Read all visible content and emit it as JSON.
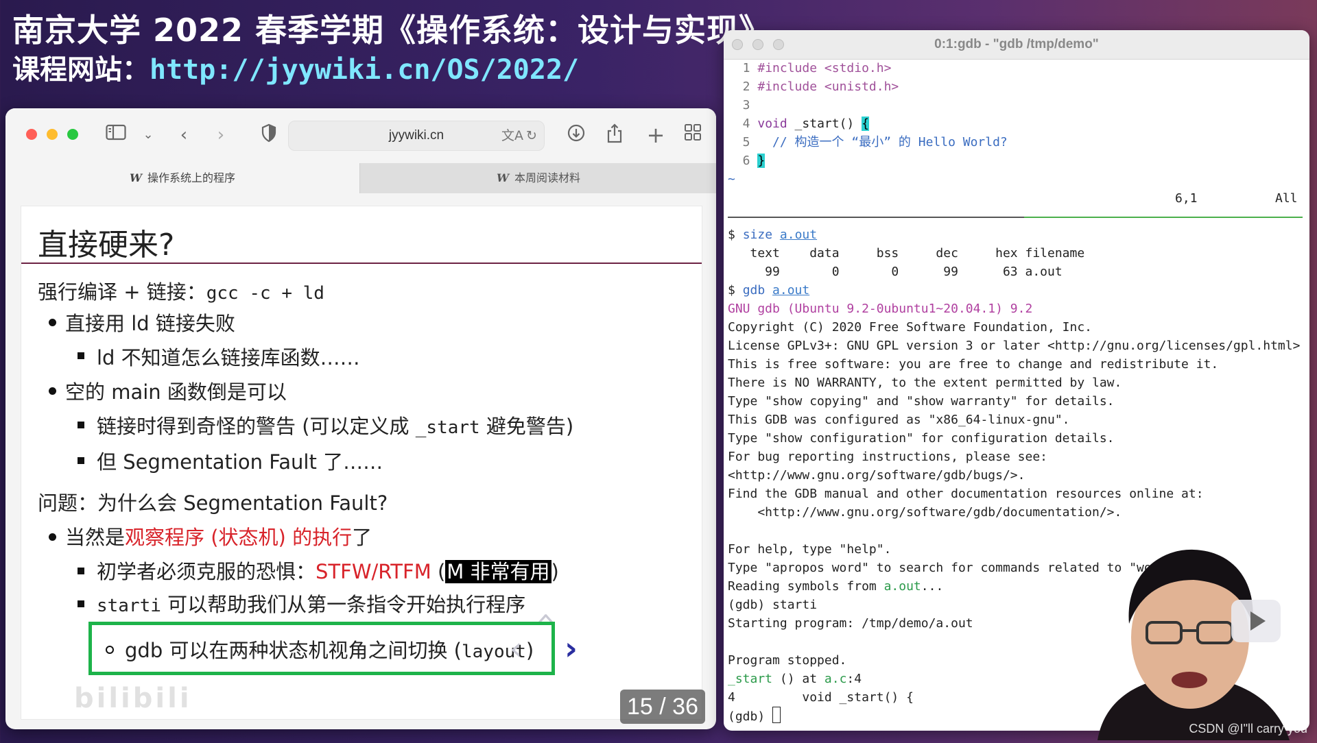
{
  "headline": {
    "line1": "南京大学 2022 春季学期《操作系统：设计与实现》",
    "line2_label": "课程网站：",
    "line2_url": "http://jyywiki.cn/OS/2022/"
  },
  "browser": {
    "url": "jyywiki.cn",
    "tabs": [
      {
        "label": "操作系统上的程序",
        "active": true
      },
      {
        "label": "本周阅读材料",
        "active": false
      }
    ],
    "icons": [
      "sidebar-icon",
      "chevron-down-icon",
      "back-icon",
      "forward-icon",
      "shield-icon",
      "translate-icon",
      "reload-icon",
      "download-icon",
      "share-icon",
      "new-tab-icon",
      "tab-overview-icon"
    ]
  },
  "slide": {
    "title": "直接硬来?",
    "intro_label": "强行编译 + 链接：",
    "intro_code": "gcc -c + ld",
    "b1": "直接用 ld 链接失败",
    "b1_1": "ld 不知道怎么链接库函数……",
    "b2": "空的 main 函数倒是可以",
    "b2_1_a": "链接时得到奇怪的警告 (可以定义成 ",
    "b2_1_code": "_start",
    "b2_1_b": " 避免警告)",
    "b2_2": "但 Segmentation Fault 了……",
    "q": "问题：为什么会 Segmentation Fault?",
    "b3_a": "当然是",
    "b3_red": "观察程序 (状态机) 的执行",
    "b3_b": "了",
    "b3_1_a": "初学者必须克服的恐惧：",
    "b3_1_red": "STFW/RTFM",
    "b3_1_open": " (",
    "b3_1_inv": "M 非常有用",
    "b3_1_close": ")",
    "b3_2_code": "starti",
    "b3_2_b": " 可以帮助我们从第一条指令开始执行程序",
    "box_a": "gdb 可以在两种状态机视角之间切换 (",
    "box_code": "layout",
    "box_b": ")",
    "page": "15 / 36",
    "watermark": "bilibili"
  },
  "terminal": {
    "title": "0:1:gdb - \"gdb /tmp/demo\"",
    "code": {
      "l1": "#include <stdio.h>",
      "l2": "#include <unistd.h>",
      "l4_kw": "void",
      "l4_rest": " _start() ",
      "l4_brace": "{",
      "l5": "  // 构造一个 “最小” 的 Hello World?",
      "l6_brace": "}",
      "tilde": "~",
      "pos": "6,1",
      "all": "All"
    },
    "size_cmd": "size",
    "size_arg": "a.out",
    "size_header": "   text    data     bss     dec     hex filename",
    "size_row": "     99       0       0      99      63 a.out",
    "gdb_cmd": "gdb",
    "gdb_arg": "a.out",
    "gdb_version": "GNU gdb (Ubuntu 9.2-0ubuntu1~20.04.1) 9.2",
    "lines": [
      "Copyright (C) 2020 Free Software Foundation, Inc.",
      "License GPLv3+: GNU GPL version 3 or later <http://gnu.org/licenses/gpl.html>",
      "This is free software: you are free to change and redistribute it.",
      "There is NO WARRANTY, to the extent permitted by law.",
      "Type \"show copying\" and \"show warranty\" for details.",
      "This GDB was configured as \"x86_64-linux-gnu\".",
      "Type \"show configuration\" for configuration details.",
      "For bug reporting instructions, please see:",
      "<http://www.gnu.org/software/gdb/bugs/>.",
      "Find the GDB manual and other documentation resources online at:",
      "    <http://www.gnu.org/software/gdb/documentation/>.",
      "",
      "For help, type \"help\".",
      "Type \"apropos word\" to search for commands related to \"word\"."
    ],
    "reading_a": "Reading symbols from ",
    "reading_file": "a.out",
    "reading_b": "...",
    "starti": "(gdb) starti",
    "starting": "Starting program: /tmp/demo/a.out",
    "stopped": "Program stopped.",
    "frame_fn": "_start",
    "frame_mid": " () at ",
    "frame_file": "a.c",
    "frame_line": ":4",
    "src_line": "4         void _start() {",
    "prompt": "(gdb) "
  },
  "credit": "CSDN @I\"ll  carry  you"
}
